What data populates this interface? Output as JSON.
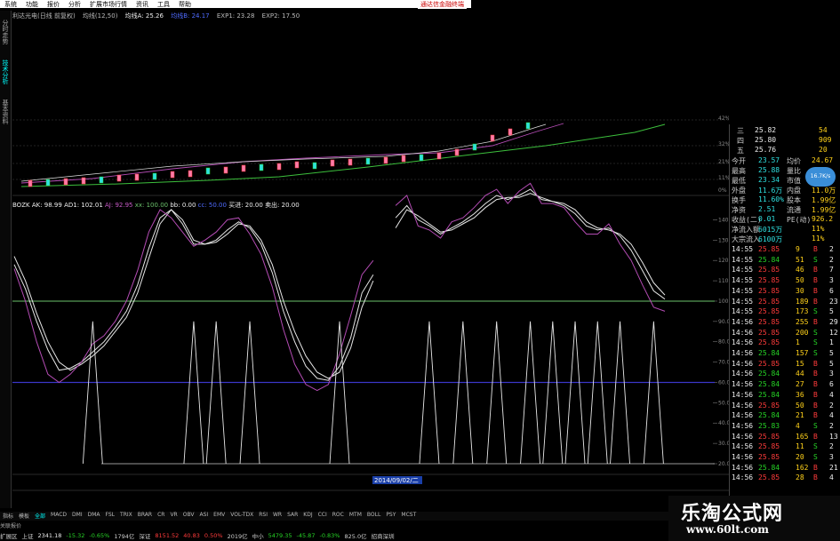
{
  "colors": {
    "up": "#ff3b3b",
    "down": "#26d426",
    "ma": "#ffd11a",
    "accent": "#2ee0e0"
  },
  "menubar": {
    "items": [
      "系统",
      "功能",
      "报价",
      "分析",
      "扩展市场行情",
      "资讯",
      "工具",
      "帮助"
    ],
    "right_link": "通达信金融终端"
  },
  "left_tabs": [
    "分时走势",
    "技术分析",
    "基本资料"
  ],
  "infoline": {
    "title": "利达光电(日线 前复权)",
    "ma": "均线(12,50)",
    "ma1": "均线A: 25.26",
    "ma2": "均线B: 24.17",
    "exp1": "EXP1: 23.28",
    "exp2": "EXP2: 17.50"
  },
  "indicator_line": {
    "name": "BOZK",
    "ak": "AK: 98.99",
    "ad1": "AD1: 102.01",
    "aj": "AJ: 92.95",
    "xx": "xx: 100.00",
    "bb": "bb: 0.00",
    "cc": "cc: 50.00",
    "buy": "买进: 20.00",
    "sell": "卖出: 20.00"
  },
  "pct_labels": [
    "42%",
    "32%",
    "21%",
    "11%",
    "0%"
  ],
  "y_labels": [
    "140.00",
    "130.00",
    "120.00",
    "110.00",
    "100.00",
    "90.00",
    "80.00",
    "70.00",
    "60.00",
    "50.00",
    "40.00",
    "30.00",
    "20.00"
  ],
  "x_label_mid": "2014/09/02/二",
  "quotes": [
    {
      "lvl": "三",
      "price": "25.82",
      "vol": "54"
    },
    {
      "lvl": "四",
      "price": "25.80",
      "vol": "909"
    },
    {
      "lvl": "五",
      "price": "25.76",
      "vol": "20"
    }
  ],
  "stats": [
    {
      "k": "今开",
      "v": "23.57",
      "k2": "均价",
      "v2": "24.67"
    },
    {
      "k": "最高",
      "v": "25.88",
      "k2": "量比",
      "v2": ""
    },
    {
      "k": "最低",
      "v": "23.34",
      "k2": "市值",
      "v2": ""
    },
    {
      "k": "外盘",
      "v": "11.6万",
      "k2": "内盘",
      "v2": "11.0万"
    },
    {
      "k": "换手",
      "v": "11.60%",
      "k2": "股本",
      "v2": "1.99亿"
    },
    {
      "k": "净资",
      "v": "2.51",
      "k2": "流通",
      "v2": "1.99亿"
    },
    {
      "k": "收益(二)",
      "v": "0.01",
      "k2": "PE(动)",
      "v2": "926.2"
    },
    {
      "k": "净流入额",
      "v": "6015万",
      "k2": "",
      "v2": "11%"
    },
    {
      "k": "大宗流入",
      "v": "6100万",
      "k2": "",
      "v2": "11%"
    }
  ],
  "ball_text": "16.7K/s",
  "ticks": [
    {
      "t": "14:55",
      "p": "25.85",
      "v": "9",
      "d": "B",
      "n": "2"
    },
    {
      "t": "14:55",
      "p": "25.84",
      "v": "51",
      "d": "S",
      "n": "2"
    },
    {
      "t": "14:55",
      "p": "25.85",
      "v": "46",
      "d": "B",
      "n": "7"
    },
    {
      "t": "14:55",
      "p": "25.85",
      "v": "50",
      "d": "B",
      "n": "3"
    },
    {
      "t": "14:55",
      "p": "25.85",
      "v": "30",
      "d": "B",
      "n": "6"
    },
    {
      "t": "14:55",
      "p": "25.85",
      "v": "189",
      "d": "B",
      "n": "23"
    },
    {
      "t": "14:55",
      "p": "25.85",
      "v": "173",
      "d": "S",
      "n": "5"
    },
    {
      "t": "14:56",
      "p": "25.85",
      "v": "255",
      "d": "B",
      "n": "29"
    },
    {
      "t": "14:56",
      "p": "25.85",
      "v": "200",
      "d": "S",
      "n": "12"
    },
    {
      "t": "14:56",
      "p": "25.85",
      "v": "1",
      "d": "S",
      "n": "1"
    },
    {
      "t": "14:56",
      "p": "25.84",
      "v": "157",
      "d": "S",
      "n": "5"
    },
    {
      "t": "14:56",
      "p": "25.85",
      "v": "15",
      "d": "B",
      "n": "5"
    },
    {
      "t": "14:56",
      "p": "25.84",
      "v": "44",
      "d": "B",
      "n": "3"
    },
    {
      "t": "14:56",
      "p": "25.84",
      "v": "27",
      "d": "B",
      "n": "6"
    },
    {
      "t": "14:56",
      "p": "25.84",
      "v": "36",
      "d": "B",
      "n": "4"
    },
    {
      "t": "14:56",
      "p": "25.85",
      "v": "50",
      "d": "B",
      "n": "2"
    },
    {
      "t": "14:56",
      "p": "25.84",
      "v": "21",
      "d": "B",
      "n": "4"
    },
    {
      "t": "14:56",
      "p": "25.83",
      "v": "4",
      "d": "S",
      "n": "2"
    },
    {
      "t": "14:56",
      "p": "25.85",
      "v": "165",
      "d": "B",
      "n": "13"
    },
    {
      "t": "14:56",
      "p": "25.85",
      "v": "11",
      "d": "S",
      "n": "2"
    },
    {
      "t": "14:56",
      "p": "25.85",
      "v": "20",
      "d": "S",
      "n": "3"
    },
    {
      "t": "14:56",
      "p": "25.84",
      "v": "162",
      "d": "B",
      "n": "21"
    },
    {
      "t": "14:56",
      "p": "25.85",
      "v": "28",
      "d": "B",
      "n": "4"
    }
  ],
  "indicator_tabs": [
    "指标",
    "模板",
    "全部",
    "MACD",
    "DMI",
    "DMA",
    "FSL",
    "TRIX",
    "BRAR",
    "CR",
    "VR",
    "OBV",
    "ASI",
    "EMV",
    "VOL-TDX",
    "RSI",
    "WR",
    "SAR",
    "KDJ",
    "CCI",
    "ROC",
    "MTM",
    "BOLL",
    "PSY",
    "MCST"
  ],
  "active_tab": "全部",
  "status": {
    "sh_label": "上证",
    "sh_val": "2341.18",
    "sh_chg": "-15.32",
    "sh_pct": "-0.65%",
    "sh_amt": "1794亿",
    "sz_label": "深证",
    "sz_val": "8151.52",
    "sz_chg": "40.83",
    "sz_pct": "0.50%",
    "sz_amt": "2019亿",
    "zx_label": "中小",
    "zx_val": "5479.35",
    "zx_chg": "-45.87",
    "zx_pct": "-0.83%",
    "zx_amt": "825.0亿",
    "tail": "招商深圳",
    "side": "扩展区",
    "side2": "关联报价"
  },
  "watermark": {
    "title": "乐淘公式网",
    "url": "www.60lt.com"
  },
  "chart_data": [
    {
      "type": "line",
      "title": "BOZK",
      "ylim": [
        20,
        145
      ],
      "series": [
        {
          "name": "AK",
          "values": [
            118,
            106,
            90,
            76,
            66,
            67,
            70,
            75,
            80,
            87,
            95,
            108,
            126,
            141,
            145,
            138,
            128,
            128,
            130,
            135,
            139,
            136,
            128,
            114,
            95,
            80,
            68,
            62,
            61,
            68,
            82,
            104,
            113,
            null,
            141,
            147,
            140,
            137,
            133,
            136,
            139,
            143,
            148,
            152,
            150,
            152,
            155,
            150,
            149,
            147,
            143,
            137,
            135,
            136,
            132,
            125,
            115,
            105,
            101
          ]
        },
        {
          "name": "AD1",
          "values": [
            122,
            110,
            94,
            80,
            70,
            66,
            69,
            73,
            78,
            85,
            92,
            104,
            121,
            138,
            145,
            140,
            130,
            128,
            129,
            133,
            138,
            137,
            130,
            118,
            100,
            85,
            73,
            65,
            62,
            65,
            77,
            97,
            110,
            null,
            136,
            145,
            142,
            138,
            134,
            135,
            138,
            141,
            146,
            150,
            151,
            151,
            153,
            151,
            149,
            148,
            145,
            139,
            136,
            135,
            133,
            128,
            119,
            109,
            103
          ]
        },
        {
          "name": "AJ",
          "values": [
            116,
            100,
            80,
            64,
            60,
            64,
            70,
            79,
            83,
            90,
            100,
            115,
            134,
            145,
            141,
            134,
            127,
            130,
            134,
            140,
            141,
            133,
            123,
            107,
            86,
            69,
            59,
            56,
            59,
            74,
            93,
            113,
            120,
            null,
            147,
            152,
            137,
            135,
            131,
            139,
            141,
            146,
            152,
            155,
            148,
            154,
            158,
            148,
            148,
            146,
            139,
            133,
            133,
            138,
            128,
            120,
            108,
            97,
            95
          ]
        },
        {
          "name": "xx",
          "values": [
            100,
            100
          ]
        },
        {
          "name": "bb",
          "values": [
            0,
            0
          ]
        },
        {
          "name": "cc",
          "values": [
            50,
            50
          ]
        }
      ],
      "signals_buy": [
        7,
        16,
        18,
        21,
        29,
        37,
        40,
        43,
        46,
        48,
        50,
        52,
        54,
        57
      ],
      "signal_low": 20,
      "signal_high": 50
    }
  ]
}
